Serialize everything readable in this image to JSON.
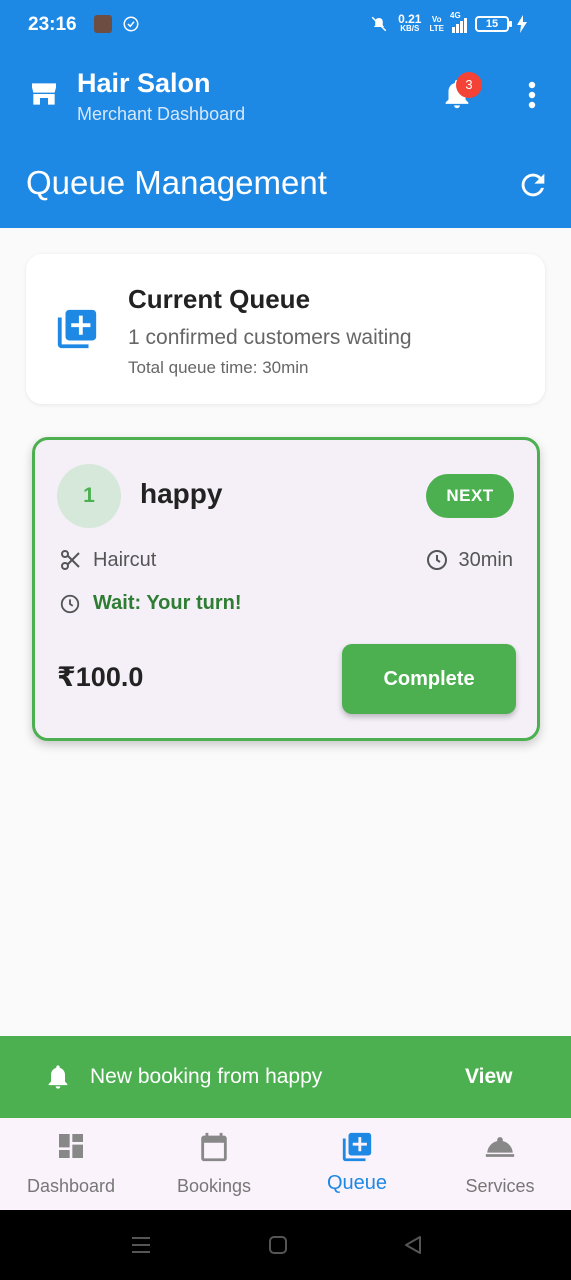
{
  "status_bar": {
    "time": "23:16",
    "net_speed_top": "0.21",
    "net_speed_unit": "KB/S",
    "volte_top": "Vo",
    "volte_bottom": "LTE",
    "network": "4G",
    "battery": "15"
  },
  "app_bar": {
    "title": "Hair Salon",
    "subtitle": "Merchant Dashboard",
    "notification_count": "3",
    "page_title": "Queue Management"
  },
  "summary": {
    "title": "Current Queue",
    "subtitle": "1 confirmed customers waiting",
    "total": "Total queue time: 30min"
  },
  "queue": [
    {
      "position": "1",
      "name": "happy",
      "badge": "NEXT",
      "service": "Haircut",
      "duration": "30min",
      "wait": "Wait: Your turn!",
      "price": "₹100.0",
      "action_label": "Complete"
    }
  ],
  "snackbar": {
    "message": "New booking from happy",
    "action": "View"
  },
  "bottom_nav": {
    "items": [
      {
        "label": "Dashboard",
        "icon": "dashboard-icon"
      },
      {
        "label": "Bookings",
        "icon": "calendar-icon"
      },
      {
        "label": "Queue",
        "icon": "queue-icon",
        "active": true
      },
      {
        "label": "Services",
        "icon": "room-service-icon"
      }
    ]
  },
  "colors": {
    "primary": "#1e88e5",
    "success": "#4caf50",
    "badge_red": "#f44336"
  }
}
